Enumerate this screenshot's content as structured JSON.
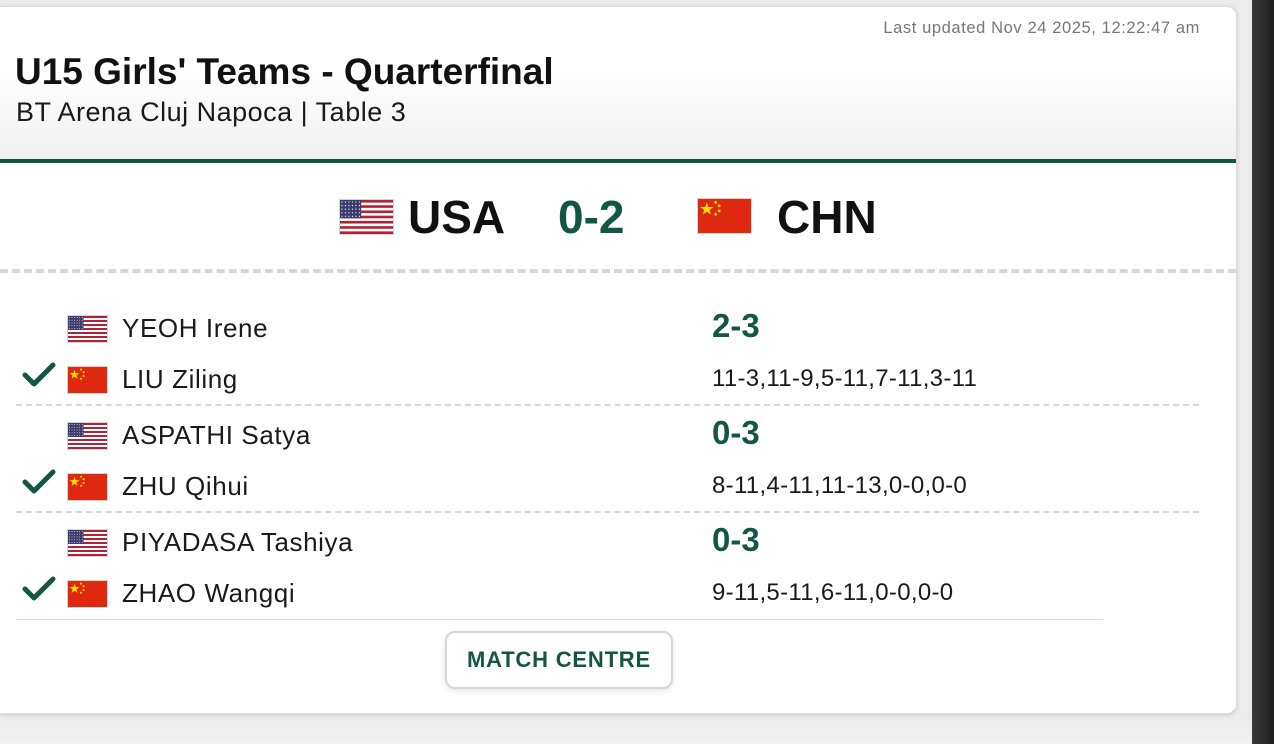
{
  "header": {
    "last_updated": "Last updated Nov 24 2025, 12:22:47 am",
    "title": "U15 Girls' Teams - Quarterfinal",
    "subtitle": "BT Arena Cluj Napoca | Table 3"
  },
  "teams": {
    "home": {
      "code": "USA",
      "flag": "usa-flag-icon"
    },
    "away": {
      "code": "CHN",
      "flag": "china-flag-icon"
    },
    "score": "0-2"
  },
  "matches": [
    {
      "home_player": "YEOH Irene",
      "away_player": "LIU Ziling",
      "score": "2-3",
      "games": "11-3,11-9,5-11,7-11,3-11",
      "winner": "away"
    },
    {
      "home_player": "ASPATHI Satya",
      "away_player": "ZHU Qihui",
      "score": "0-3",
      "games": "8-11,4-11,11-13,0-0,0-0",
      "winner": "away"
    },
    {
      "home_player": "PIYADASA Tashiya",
      "away_player": "ZHAO Wangqi",
      "score": "0-3",
      "games": "9-11,5-11,6-11,0-0,0-0",
      "winner": "away"
    }
  ],
  "buttons": {
    "match_centre": "MATCH CENTRE"
  },
  "colors": {
    "accent": "#135646",
    "text": "#111111",
    "muted": "#777777"
  }
}
